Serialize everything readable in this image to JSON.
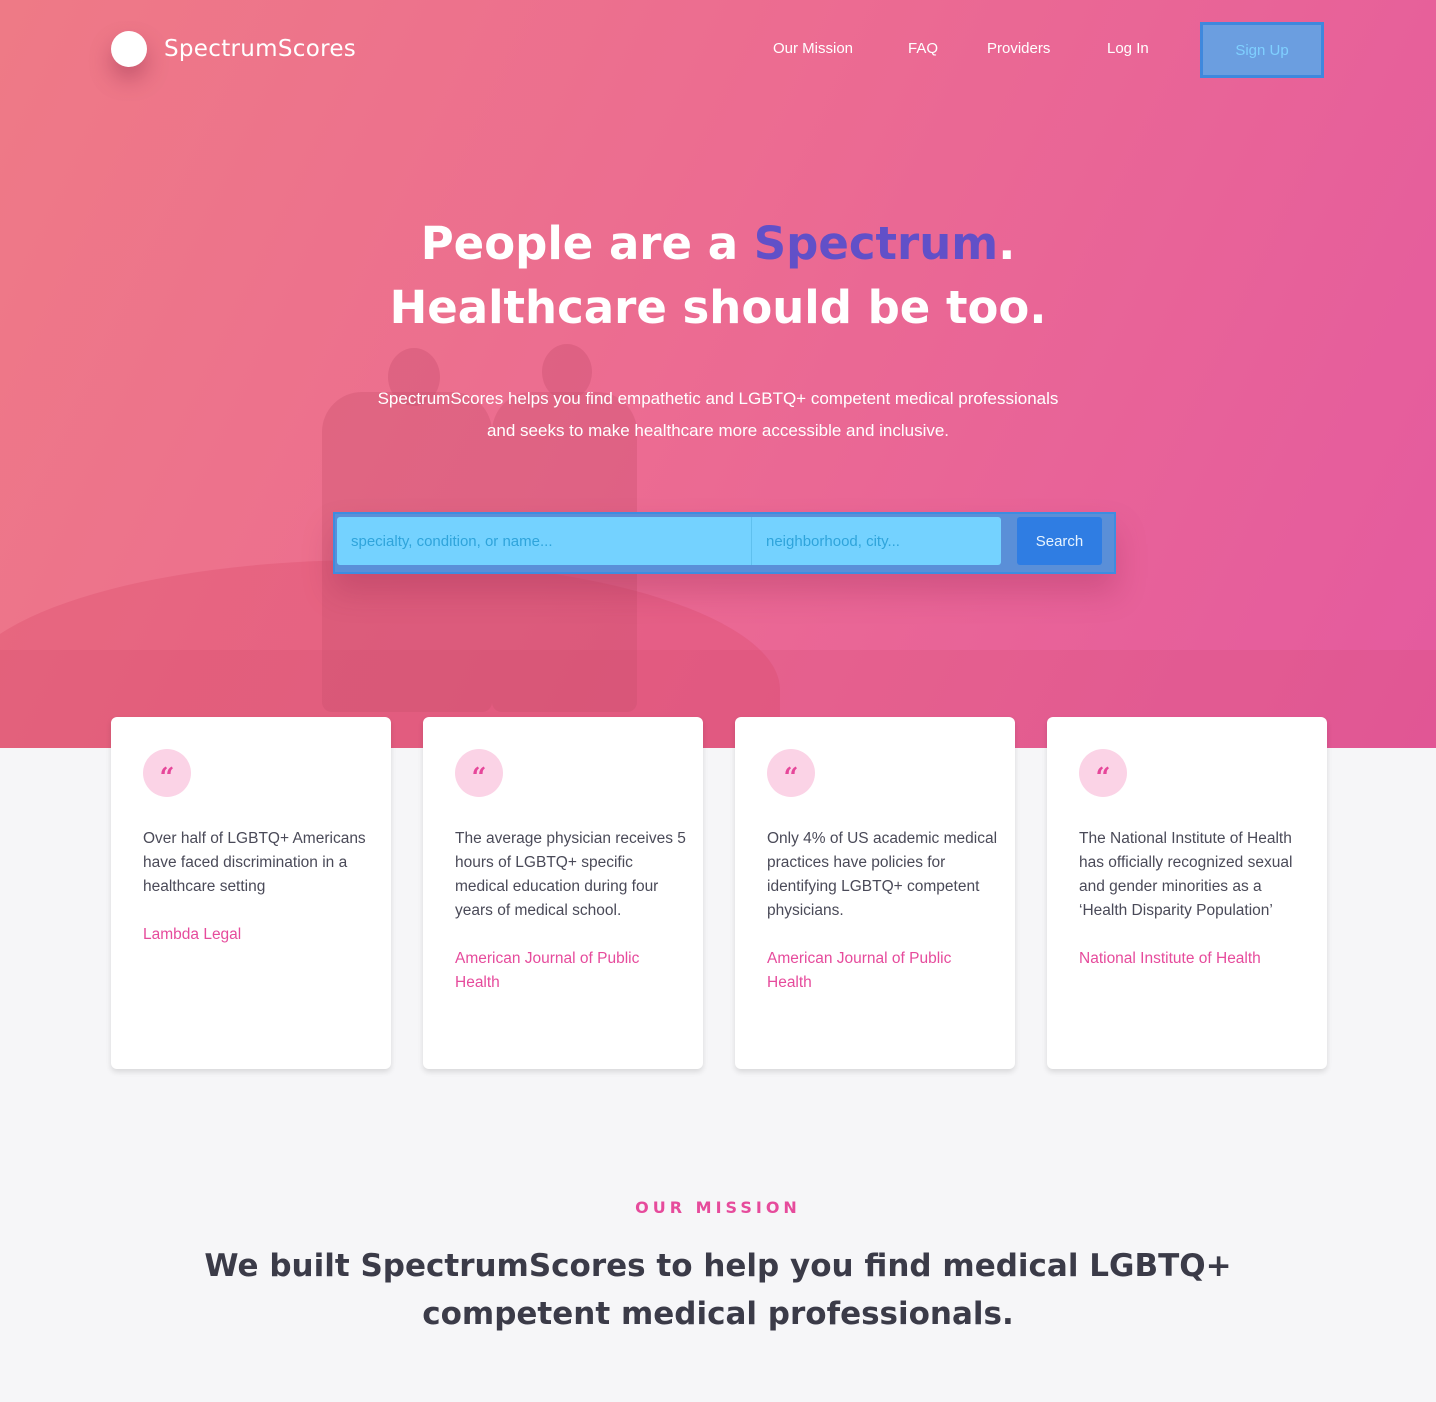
{
  "brand": {
    "name": "SpectrumScores"
  },
  "nav": {
    "items": [
      {
        "label": "Our Mission"
      },
      {
        "label": "FAQ"
      },
      {
        "label": "Providers"
      },
      {
        "label": "Log In"
      }
    ],
    "signup_label": "Sign Up"
  },
  "hero": {
    "headline_line1_pre": "People are a ",
    "headline_accent": "Spectrum",
    "headline_line1_post": ".",
    "headline_line2": "Healthcare should be too.",
    "subtitle_line1": "SpectrumScores helps you find empathetic and LGBTQ+ competent medical professionals",
    "subtitle_line2": "and seeks to make healthcare more accessible and inclusive."
  },
  "search": {
    "query_placeholder": "specialty, condition, or name...",
    "location_placeholder": "neighborhood, city...",
    "button_label": "Search"
  },
  "stats": [
    {
      "text": "Over half of LGBTQ+ Americans have faced discrimination in a healthcare setting",
      "source": "Lambda Legal"
    },
    {
      "text": "The average physician receives 5 hours of LGBTQ+ specific medical education during four years of medical school.",
      "source": "American Journal of Public Health"
    },
    {
      "text": "Only 4% of US academic medical practices have policies for identifying LGBTQ+ competent physicians.",
      "source": "American Journal of Public Health"
    },
    {
      "text": "The National Institute of Health has officially recognized sexual and gender minorities as a ‘Health Disparity Population’",
      "source": "National Institute of Health"
    }
  ],
  "mission": {
    "label": "OUR MISSION",
    "title_line1": "We built SpectrumScores to help you find medical LGBTQ+",
    "title_line2": "competent medical professionals."
  },
  "colors": {
    "accent_pink": "#e64b9c",
    "accent_purple": "#6150c8",
    "search_field": "#74d2ff",
    "search_button": "#2f7de3"
  }
}
